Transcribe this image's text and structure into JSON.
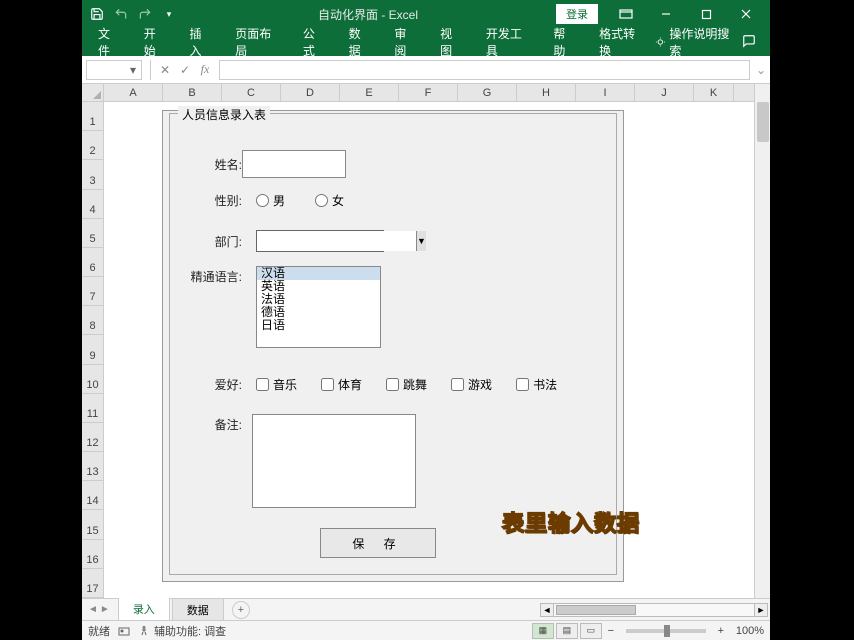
{
  "title": "自动化界面 - Excel",
  "login": "登录",
  "ribbon": {
    "tabs": [
      "文件",
      "开始",
      "插入",
      "页面布局",
      "公式",
      "数据",
      "审阅",
      "视图",
      "开发工具",
      "帮助",
      "格式转换"
    ],
    "tell_me": "操作说明搜索"
  },
  "formula_bar": {
    "name_box": "",
    "fx": "fx",
    "value": ""
  },
  "columns": [
    "A",
    "B",
    "C",
    "D",
    "E",
    "F",
    "G",
    "H",
    "I",
    "J",
    "K"
  ],
  "rows": [
    "1",
    "2",
    "3",
    "4",
    "5",
    "6",
    "7",
    "8",
    "9",
    "10",
    "11",
    "12",
    "13",
    "14",
    "15",
    "16",
    "17"
  ],
  "form": {
    "group_title": "人员信息录入表",
    "name_label": "姓名:",
    "gender_label": "性别:",
    "gender_male": "男",
    "gender_female": "女",
    "dept_label": "部门:",
    "lang_label": "精通语言:",
    "lang_options": [
      "汉语",
      "英语",
      "法语",
      "德语",
      "日语"
    ],
    "hobby_label": "爱好:",
    "hobby_options": [
      "音乐",
      "体育",
      "跳舞",
      "游戏",
      "书法"
    ],
    "remark_label": "备注:",
    "save": "保 存"
  },
  "overlay_caption": "表里输入数据",
  "sheets": {
    "active": "录入",
    "other": "数据"
  },
  "status": {
    "ready": "就绪",
    "access": "辅助功能: 调查",
    "zoom": "100%"
  }
}
